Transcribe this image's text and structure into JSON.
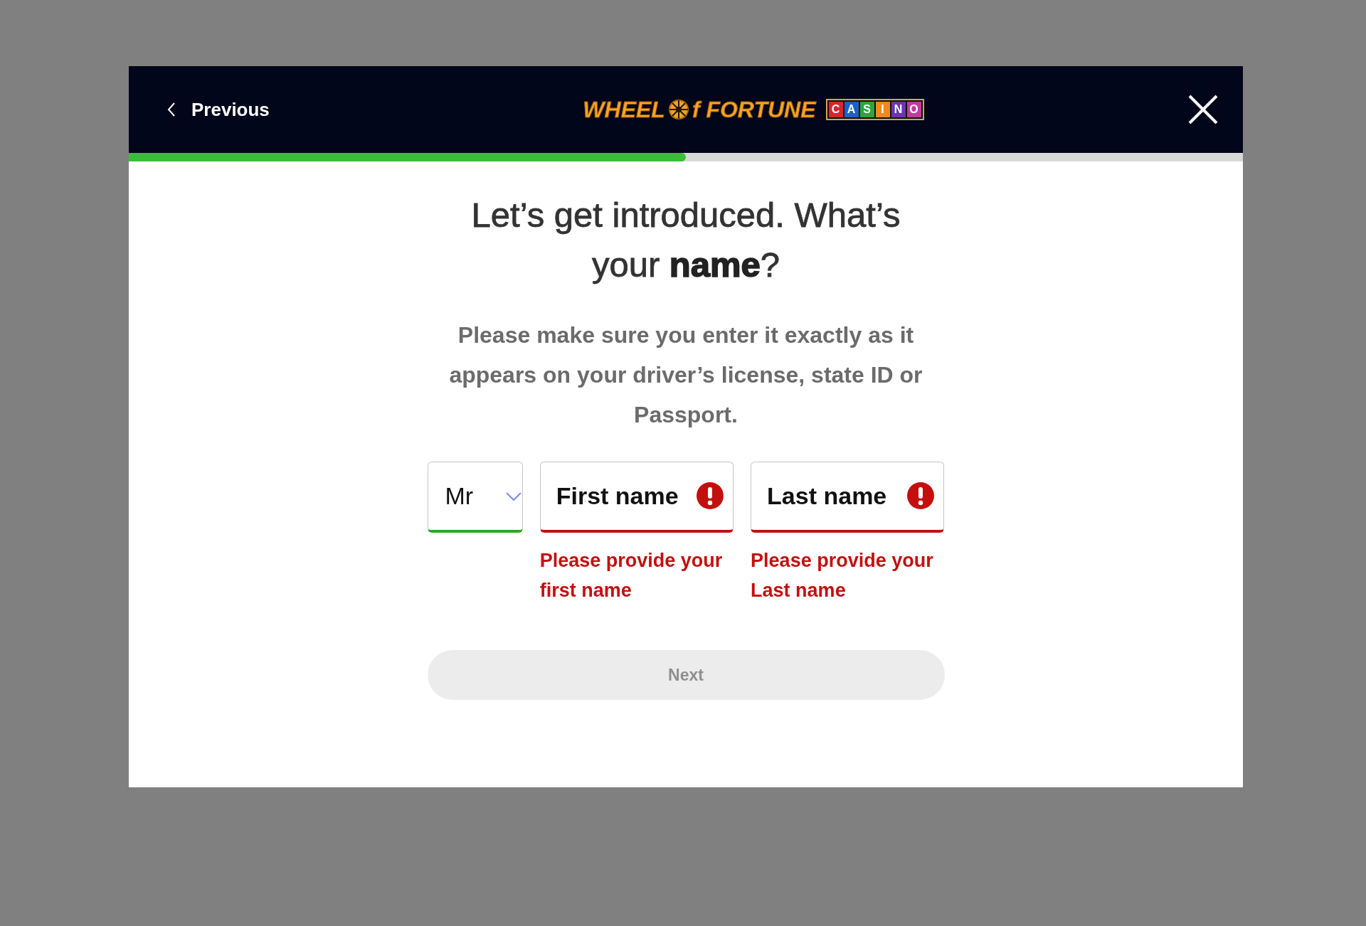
{
  "header": {
    "back_label": "Previous",
    "logo": {
      "words": [
        "WHEEL",
        "f FORTUNE"
      ],
      "casino_letters": [
        {
          "letter": "C",
          "color": "#d7262b"
        },
        {
          "letter": "A",
          "color": "#1f5fc9"
        },
        {
          "letter": "S",
          "color": "#2fa43a"
        },
        {
          "letter": "I",
          "color": "#f08a1c"
        },
        {
          "letter": "N",
          "color": "#6a35b5"
        },
        {
          "letter": "O",
          "color": "#c23aa0"
        }
      ]
    }
  },
  "progress": {
    "level": 0.5
  },
  "heading": "Let’s get introduced. What’s your **name**?",
  "instructions": "Please make sure you enter it exactly as it appears on your driver’s license, state ID or Passport.",
  "fields": [
    {
      "kind": "select",
      "value": "Mr",
      "invalid": false
    },
    {
      "kind": "text",
      "placeholder": "First name",
      "invalid": true,
      "error": "Please provide your first name"
    },
    {
      "kind": "text",
      "placeholder": "Last name",
      "invalid": true,
      "error": "Please provide your Last name"
    }
  ],
  "next_button": {
    "label": "Next",
    "disabled": true
  }
}
